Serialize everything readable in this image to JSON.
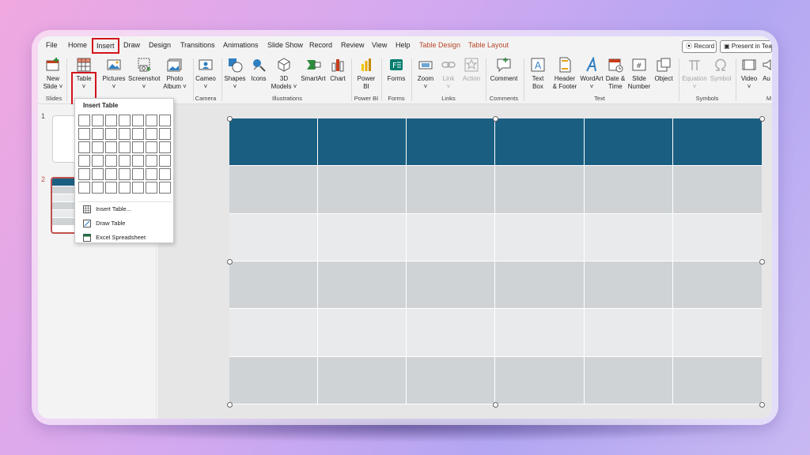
{
  "tabs": [
    "File",
    "Home",
    "Insert",
    "Draw",
    "Design",
    "Transitions",
    "Animations",
    "Slide Show",
    "Record",
    "Review",
    "View",
    "Help",
    "Table Design",
    "Table Layout"
  ],
  "actions": {
    "record": "Record",
    "present": "Present in Tea"
  },
  "ribbon": {
    "new_slide": [
      "New",
      "Slide ˅"
    ],
    "table": [
      "Table",
      "˅"
    ],
    "pictures": [
      "Pictures",
      "˅"
    ],
    "screenshot": [
      "Screenshot",
      "˅"
    ],
    "photo_album": [
      "Photo",
      "Album ˅"
    ],
    "cameo": [
      "Cameo",
      "˅"
    ],
    "shapes": [
      "Shapes",
      "˅"
    ],
    "icons": [
      "Icons",
      ""
    ],
    "models3d": [
      "3D",
      "Models ˅"
    ],
    "smartart": [
      "SmartArt",
      ""
    ],
    "chart": [
      "Chart",
      ""
    ],
    "powerbi": [
      "Power",
      "BI"
    ],
    "forms": [
      "Forms",
      ""
    ],
    "zoom": [
      "Zoom",
      "˅"
    ],
    "link": [
      "Link",
      "˅"
    ],
    "action": [
      "Action",
      ""
    ],
    "comment": [
      "Comment",
      ""
    ],
    "textbox": [
      "Text",
      "Box"
    ],
    "header_footer": [
      "Header",
      "& Footer"
    ],
    "wordart": [
      "WordArt",
      "˅"
    ],
    "datetime": [
      "Date &",
      "Time"
    ],
    "slide_number": [
      "Slide",
      "Number"
    ],
    "object": [
      "Object",
      ""
    ],
    "equation": [
      "Equation",
      "˅"
    ],
    "symbol": [
      "Symbol",
      ""
    ],
    "video": [
      "Video",
      "˅"
    ],
    "audio": [
      "Au",
      ""
    ]
  },
  "groups": {
    "slides": "Slides",
    "camera": "Camera",
    "illustrations": "Illustrations",
    "powerbi": "Power BI",
    "forms": "Forms",
    "links": "Links",
    "comments": "Comments",
    "text": "Text",
    "symbols": "Symbols",
    "media": "M"
  },
  "slide_numbers": [
    "1",
    "2"
  ],
  "dropdown": {
    "title": "Insert Table",
    "items": [
      "Insert Table...",
      "Draw Table",
      "Excel Spreadsheet"
    ]
  },
  "colors": {
    "header": "#1a5e82",
    "band_dark": "#cfd3d6",
    "band_light": "#e8eaeb",
    "accent_red": "#d4131b"
  }
}
